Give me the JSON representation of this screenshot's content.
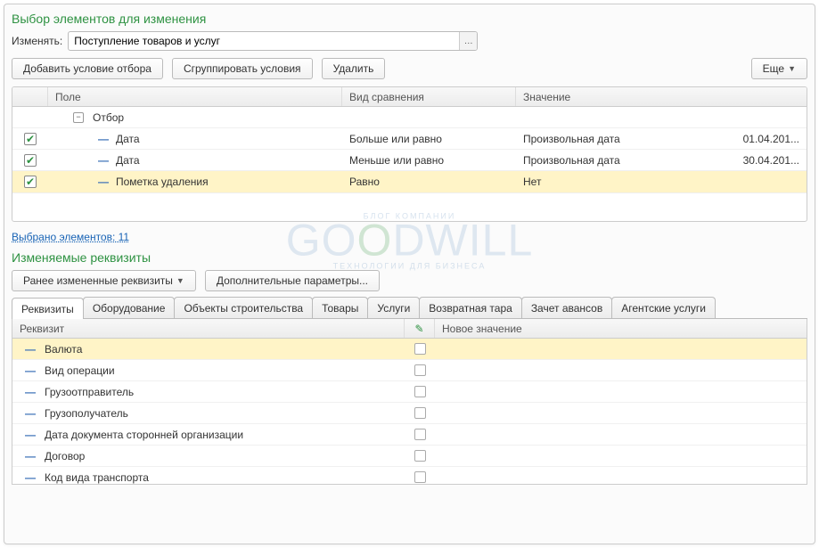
{
  "section1_title": "Выбор элементов для изменения",
  "change_label": "Изменять:",
  "change_value": "Поступление товаров и услуг",
  "buttons": {
    "add_filter": "Добавить условие отбора",
    "group_filter": "Сгруппировать условия",
    "delete": "Удалить",
    "more": "Еще",
    "prev_changed": "Ранее измененные реквизиты",
    "extra_params": "Дополнительные параметры..."
  },
  "filter_head": {
    "field": "Поле",
    "cmp": "Вид сравнения",
    "val": "Значение"
  },
  "filter_root": "Отбор",
  "filter_rows": [
    {
      "checked": true,
      "field": "Дата",
      "cmp": "Больше или равно",
      "val": "Произвольная дата",
      "val2": "01.04.201..."
    },
    {
      "checked": true,
      "field": "Дата",
      "cmp": "Меньше или равно",
      "val": "Произвольная дата",
      "val2": "30.04.201..."
    },
    {
      "checked": true,
      "field": "Пометка удаления",
      "cmp": "Равно",
      "val": "Нет",
      "val2": "",
      "selected": true
    }
  ],
  "selected_link": "Выбрано элементов: 11",
  "section2_title": "Изменяемые реквизиты",
  "tabs": [
    "Реквизиты",
    "Оборудование",
    "Объекты строительства",
    "Товары",
    "Услуги",
    "Возвратная тара",
    "Зачет авансов",
    "Агентские услуги"
  ],
  "req_head": {
    "name": "Реквизит",
    "newval": "Новое значение"
  },
  "req_rows": [
    {
      "name": "Валюта",
      "selected": true
    },
    {
      "name": "Вид операции"
    },
    {
      "name": "Грузоотправитель"
    },
    {
      "name": "Грузополучатель"
    },
    {
      "name": "Дата документа сторонней организации"
    },
    {
      "name": "Договор"
    },
    {
      "name": "Код вида транспорта"
    }
  ],
  "watermark": {
    "top": "БЛОГ КОМПАНИИ",
    "main1": "G",
    "main_o": "O",
    "main_o2": "O",
    "main_rest": "DWILL",
    "bottom": "ТЕХНОЛОГИИ  ДЛЯ  БИЗНЕСА"
  }
}
